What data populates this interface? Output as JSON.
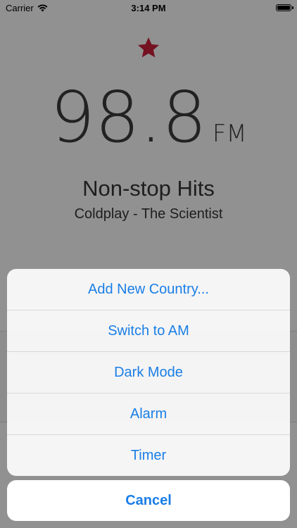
{
  "status_bar": {
    "carrier": "Carrier",
    "time": "3:14 PM"
  },
  "radio": {
    "frequency": "98.8",
    "band": "FM",
    "station": "Non-stop Hits",
    "now_playing": "Coldplay - The Scientist",
    "favorite_color": "#c41e3a"
  },
  "action_sheet": {
    "items": [
      {
        "label": "Add New Country..."
      },
      {
        "label": "Switch to AM"
      },
      {
        "label": "Dark Mode"
      },
      {
        "label": "Alarm"
      },
      {
        "label": "Timer"
      }
    ],
    "cancel_label": "Cancel",
    "accent": "#1a7ee6"
  }
}
